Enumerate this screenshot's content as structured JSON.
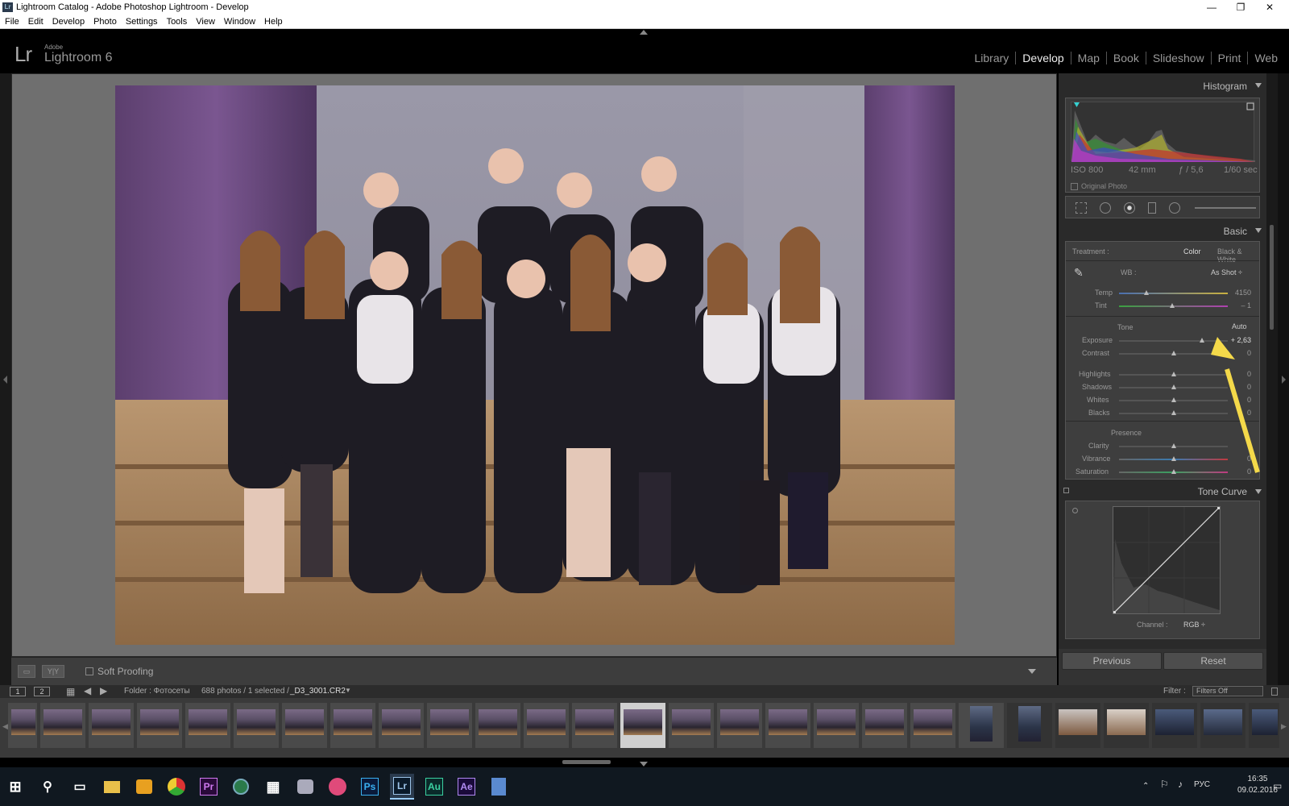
{
  "window": {
    "title": "Lightroom Catalog - Adobe Photoshop Lightroom - Develop",
    "app_icon": "Lr"
  },
  "menu": [
    "File",
    "Edit",
    "Develop",
    "Photo",
    "Settings",
    "Tools",
    "View",
    "Window",
    "Help"
  ],
  "identity": {
    "logo": "Lr",
    "adobe": "Adobe",
    "product": "Lightroom 6"
  },
  "modules": [
    {
      "label": "Library"
    },
    {
      "label": "Develop",
      "active": true
    },
    {
      "label": "Map"
    },
    {
      "label": "Book"
    },
    {
      "label": "Slideshow"
    },
    {
      "label": "Print"
    },
    {
      "label": "Web"
    }
  ],
  "toolbar": {
    "soft_proofing": "Soft Proofing",
    "soft_proofing_checked": false
  },
  "histogram": {
    "title": "Histogram",
    "iso": "ISO 800",
    "focal": "42 mm",
    "aperture": "ƒ / 5,6",
    "shutter": "1/60 sec",
    "original_photo": "Original Photo"
  },
  "basic": {
    "title": "Basic",
    "treatment_label": "Treatment :",
    "treatment_color": "Color",
    "treatment_bw": "Black & White",
    "wb_label": "WB :",
    "wb_value": "As Shot ÷",
    "tone_label": "Tone",
    "auto_label": "Auto",
    "presence_label": "Presence",
    "sliders": [
      {
        "label": "Temp",
        "value": "4150",
        "level": 0.25
      },
      {
        "label": "Tint",
        "value": "– 1",
        "level": 0.49
      },
      {
        "label": "Exposure",
        "value": "+ 2,63",
        "level": 0.76
      },
      {
        "label": "Contrast",
        "value": "0",
        "level": 0.5
      },
      {
        "label": "Highlights",
        "value": "0",
        "level": 0.5
      },
      {
        "label": "Shadows",
        "value": "0",
        "level": 0.5
      },
      {
        "label": "Whites",
        "value": "0",
        "level": 0.5
      },
      {
        "label": "Blacks",
        "value": "0",
        "level": 0.5
      },
      {
        "label": "Clarity",
        "value": "",
        "level": 0.5
      },
      {
        "label": "Vibrance",
        "value": "0",
        "level": 0.5
      },
      {
        "label": "Saturation",
        "value": "0",
        "level": 0.5
      }
    ]
  },
  "tone_curve": {
    "title": "Tone Curve",
    "channel_label": "Channel :",
    "channel_value": "RGB ÷"
  },
  "buttons": {
    "previous": "Previous",
    "reset": "Reset"
  },
  "filmstrip": {
    "view1": "1",
    "view2": "2",
    "source": "Folder : Фотосеты",
    "count": "688 photos / 1 selected /",
    "filename": "_D3_3001.CR2",
    "filter_label": "Filter :",
    "filter_value": "Filters Off"
  },
  "taskbar": {
    "apps": [
      "Windows",
      "Search",
      "Task View",
      "File Explorer",
      "Media Player",
      "Premiere Pro",
      "Chrome",
      "Network",
      "Calculator",
      "Photo Viewer",
      "Paint",
      "Photoshop",
      "Lightroom",
      "Audition",
      "After Effects",
      "Notepad"
    ],
    "lang": "РУС",
    "time": "16:35",
    "date": "09.02.2016"
  },
  "colors": {
    "annotation_arrow": "#f4d94a",
    "panel": "#3e3e3e",
    "background": "#000000"
  }
}
